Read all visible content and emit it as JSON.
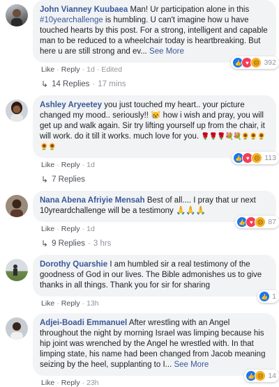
{
  "comments": [
    {
      "author": "John Vianney Kuubaea",
      "pre": "Man! Ur participation alone in this ",
      "hashtag": "#10yearchallenge",
      "text": " is humbling. U can't imagine how u have touched hearts by this post. For a strong, intelligent and capable man to be reduced to a wheelchair today is heartbreaking. But here u are still strong and ev...",
      "see_more": "See More",
      "reactions": [
        "like-icon",
        "love-icon",
        "sad-icon"
      ],
      "reaction_count": "392",
      "like": "Like",
      "reply": "Reply",
      "time": "1d",
      "edited": "Edited",
      "replies": "14 Replies",
      "replies_time": "17 mins"
    },
    {
      "author": "Ashley Aryeetey",
      "text": "you just touched my heart.. your picture changed my mood.. seriously!! 😿 how i wish and pray, you will get up and walk again. Sir try lifting yourself up from the chair, it will work. do it till it works. much love for you.",
      "emoji_tail": "🌹🌹🌹💐💐🌻🌻🌻🌻🌻",
      "reactions": [
        "like-icon",
        "love-icon",
        "sad-icon"
      ],
      "reaction_count": "113",
      "like": "Like",
      "reply": "Reply",
      "time": "1d",
      "replies": "7 Replies"
    },
    {
      "author": "Nana Abena Afriyie Mensah",
      "text": "Best of all.... I pray that ur next 10yreardchallenge will be a testimony 🙏🙏🙏",
      "reactions": [
        "like-icon",
        "love-icon",
        "sad-icon"
      ],
      "reaction_count": "87",
      "like": "Like",
      "reply": "Reply",
      "time": "1d",
      "replies": "9 Replies",
      "replies_time": "3 hrs"
    },
    {
      "author": "Dorothy Quarshie",
      "text": "I am humbled sir a real testimony of the goodness of God in our lives. The Bible admonishes us to give thanks in all things. Thank you for sir for sharing",
      "reactions": [
        "like-icon"
      ],
      "reaction_count": "1",
      "like": "Like",
      "reply": "Reply",
      "time": "13h"
    },
    {
      "author": "Adjei-Boadi Emmanuel",
      "text": "After wrestling with an Angel throughout the night by morning Israel was limping because his hip joint was wrenched by the Angel he wrestled with. In that limping state, his name had been changed from Jacob meaning seizing by the heel, supplanting to I...",
      "see_more": "See More",
      "reactions": [
        "like-icon",
        "sad-icon"
      ],
      "reaction_count": "14",
      "like": "Like",
      "reply": "Reply",
      "time": "23h"
    }
  ],
  "colors": {
    "link": "#385898",
    "bubble": "#f2f3f5",
    "muted": "#90949c"
  }
}
